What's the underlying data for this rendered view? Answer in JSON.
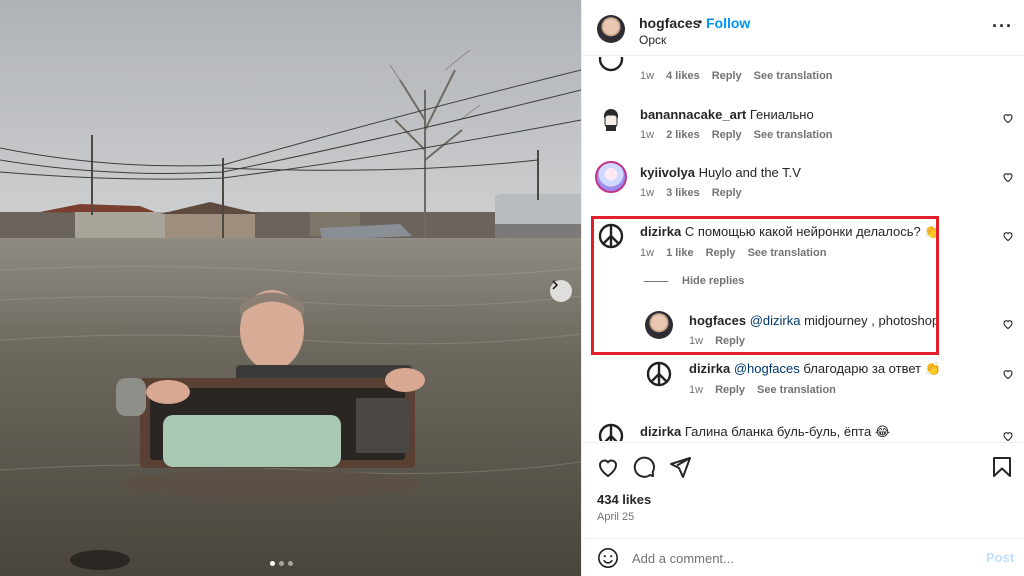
{
  "post": {
    "author": "hogfaces",
    "separator": "•",
    "follow_label": "Follow",
    "location": "Орск",
    "more_icon": "more-horizontal-icon"
  },
  "photo": {
    "carousel_next_icon": "chevron-right-icon",
    "carousel_dots": 3,
    "active_dot": 1
  },
  "comments": [
    {
      "user": "",
      "text": "",
      "time": "1w",
      "likes": "4 likes",
      "reply": "Reply",
      "translate": "See translation"
    },
    {
      "user": "banannacake_art",
      "text": "Гениально",
      "time": "1w",
      "likes": "2 likes",
      "reply": "Reply",
      "translate": "See translation"
    },
    {
      "user": "kyiivolya",
      "text": "Huylo and the T.V",
      "time": "1w",
      "likes": "3 likes",
      "reply": "Reply",
      "translate": ""
    },
    {
      "user": "dizirka",
      "text": "С помощью какой нейронки делалось? 👏",
      "time": "1w",
      "likes": "1 like",
      "reply": "Reply",
      "translate": "See translation"
    }
  ],
  "hide_replies_label": "Hide replies",
  "replies": [
    {
      "user": "hogfaces",
      "mention": "@dizirka",
      "text": " midjourney , photoshop",
      "time": "1w",
      "reply": "Reply"
    },
    {
      "user": "dizirka",
      "mention": "@hogfaces",
      "text": " благодарю за ответ 👏",
      "time": "1w",
      "reply": "Reply",
      "translate": "See translation"
    }
  ],
  "last_comment": {
    "user": "dizirka",
    "text": "Галина бланка буль-буль, ёпта 😂"
  },
  "actions": {
    "like_icon": "heart-icon",
    "comment_icon": "comment-icon",
    "share_icon": "share-icon",
    "save_icon": "bookmark-icon",
    "likes": "434 likes",
    "date": "April 25"
  },
  "composer": {
    "emoji_icon": "emoji-icon",
    "placeholder": "Add a comment...",
    "post_label": "Post"
  },
  "colors": {
    "accent": "#0095f6",
    "highlight": "#e1202c",
    "muted": "#737373"
  }
}
